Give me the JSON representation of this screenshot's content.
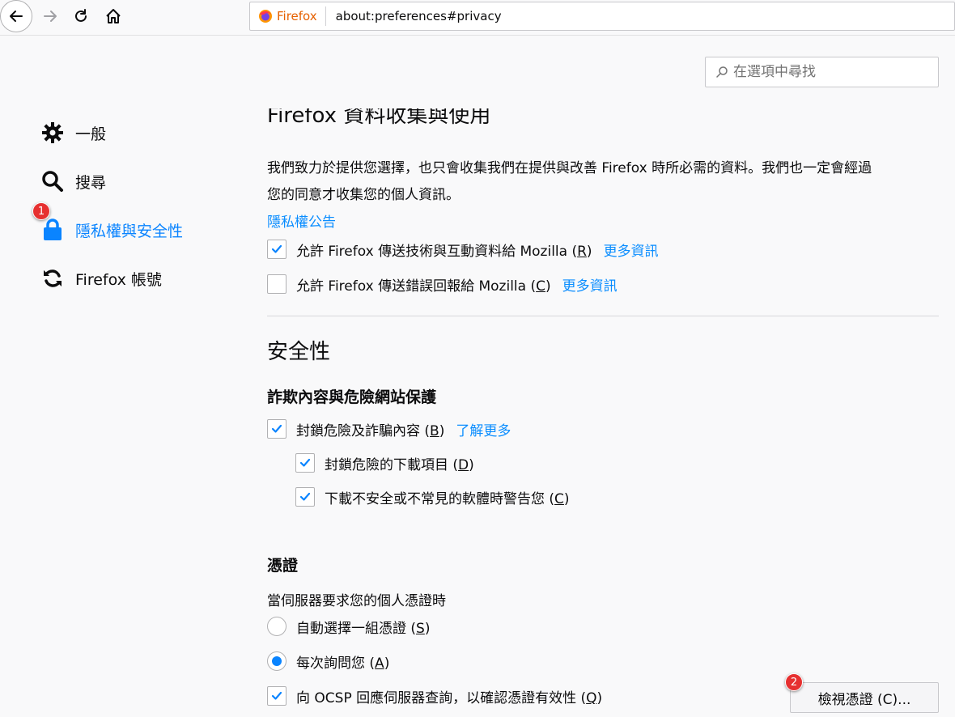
{
  "toolbar": {
    "identity_label": "Firefox",
    "url": "about:preferences#privacy"
  },
  "search": {
    "placeholder": "在選項中尋找"
  },
  "sidebar": {
    "items": [
      {
        "label": "一般",
        "icon": "gear-icon"
      },
      {
        "label": "搜尋",
        "icon": "search-icon"
      },
      {
        "label": "隱私權與安全性",
        "icon": "lock-icon",
        "selected": true
      },
      {
        "label": "Firefox 帳號",
        "icon": "sync-icon"
      }
    ]
  },
  "badges": {
    "one": "1",
    "two": "2"
  },
  "data_collection": {
    "heading": "Firefox 資料收集與使用",
    "desc_line1": "我們致力於提供您選擇，也只會收集我們在提供與改善 Firefox 時所必需的資料。我們也一定會經過",
    "desc_line2": "您的同意才收集您的個人資訊。",
    "privacy_notice": "隱私權公告",
    "telemetry_label": "允許 Firefox 傳送技術與互動資料給 Mozilla",
    "telemetry_key": "R",
    "telemetry_checked": true,
    "crash_label": "允許 Firefox 傳送錯誤回報給 Mozilla",
    "crash_key": "C",
    "crash_checked": false,
    "learn_more": "更多資訊"
  },
  "security": {
    "heading": "安全性",
    "deceptive_heading": "詐欺內容與危險網站保護",
    "block_dangerous_label": "封鎖危險及詐騙內容",
    "block_dangerous_key": "B",
    "learn_more": "了解更多",
    "block_downloads_label": "封鎖危險的下載項目",
    "block_downloads_key": "D",
    "warn_software_label": "下載不安全或不常見的軟體時警告您",
    "warn_software_key": "C"
  },
  "certificates": {
    "heading": "憑證",
    "prompt": "當伺服器要求您的個人憑證時",
    "auto_select_label": "自動選擇一組憑證",
    "auto_select_key": "S",
    "ask_label": "每次詢問您",
    "ask_key": "A",
    "selected_option": "每次詢問您",
    "ocsp_label": "向 OCSP 回應伺服器查詢，以確認憑證有效性",
    "ocsp_key": "Q",
    "view_button": "檢視憑證 (C)..."
  },
  "colors": {
    "accent": "#0a84ff",
    "link": "#0a8dff",
    "badge": "#e63030",
    "firefox_orange": "#e66000"
  }
}
